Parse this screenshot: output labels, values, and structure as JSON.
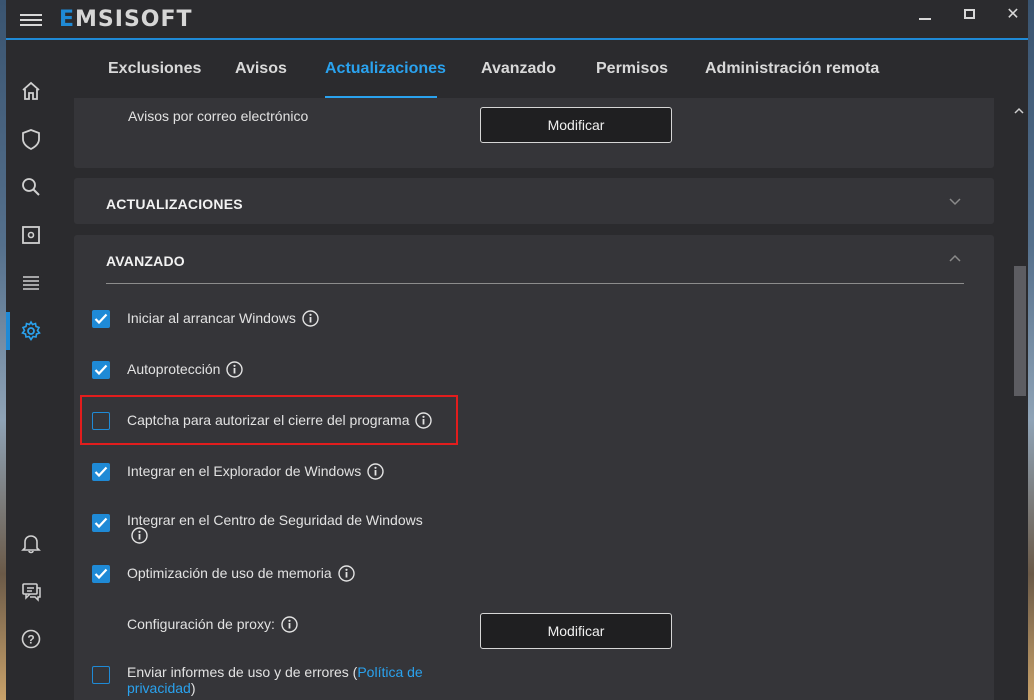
{
  "window": {
    "brand": "EMSISOFT"
  },
  "tabs": [
    {
      "label": "Exclusiones",
      "active": false
    },
    {
      "label": "Avisos",
      "active": false
    },
    {
      "label": "Actualizaciones",
      "active": true
    },
    {
      "label": "Avanzado",
      "active": false
    },
    {
      "label": "Permisos",
      "active": false
    },
    {
      "label": "Administración remota",
      "active": false
    }
  ],
  "sidebar": {
    "items": [
      {
        "icon": "home-icon"
      },
      {
        "icon": "shield-icon"
      },
      {
        "icon": "search-icon"
      },
      {
        "icon": "quarantine-icon"
      },
      {
        "icon": "logs-icon"
      },
      {
        "icon": "gear-icon",
        "active": true
      },
      {
        "icon": "bell-icon"
      },
      {
        "icon": "chat-icon"
      },
      {
        "icon": "help-icon"
      }
    ]
  },
  "email": {
    "label": "Avisos por correo electrónico",
    "button": "Modificar"
  },
  "updates": {
    "title": "ACTUALIZACIONES"
  },
  "advanced": {
    "title": "AVANZADO",
    "options": [
      {
        "label": "Iniciar al arrancar Windows",
        "checked": true
      },
      {
        "label": "Autoprotección",
        "checked": true
      },
      {
        "label": "Captcha para autorizar el cierre del programa",
        "checked": false,
        "highlighted": true
      },
      {
        "label": "Integrar en el Explorador de Windows",
        "checked": true
      },
      {
        "label": "Integrar en el Centro de Seguridad de Windows",
        "checked": true
      },
      {
        "label": "Optimización de uso de memoria",
        "checked": true
      }
    ],
    "proxy": {
      "label": "Configuración de proxy:",
      "button": "Modificar"
    },
    "reports": {
      "label": "Enviar informes de uso y de errores (",
      "link": "Política de privacidad",
      "suffix": ")",
      "checked": false
    }
  },
  "colors": {
    "accent": "#1f8ad6",
    "highlight": "#e21d1d",
    "card": "#353539",
    "background": "#2b2b2e"
  }
}
